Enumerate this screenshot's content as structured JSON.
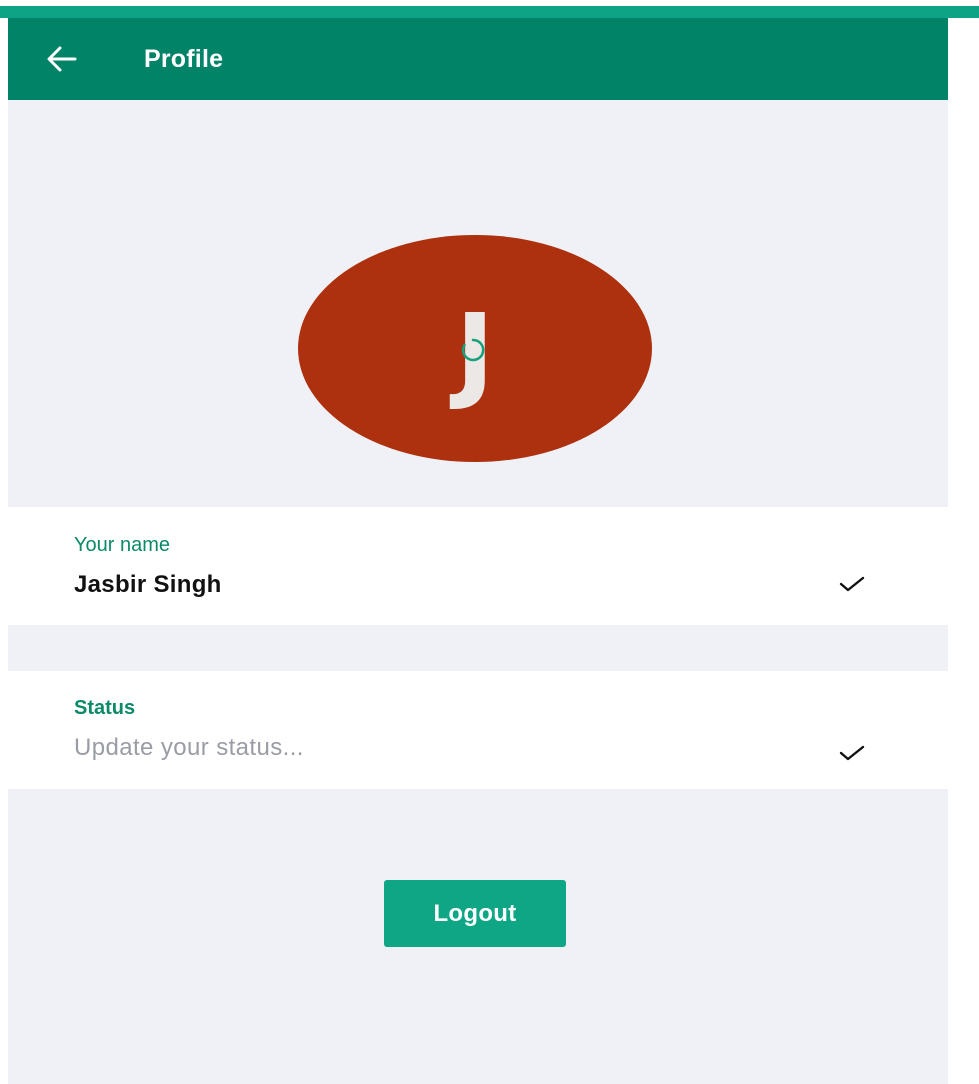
{
  "header": {
    "title": "Profile",
    "back_icon": "arrow-left-icon"
  },
  "avatar": {
    "initial": "J",
    "background_color": "#ad310e",
    "loading_icon": "spinner-icon"
  },
  "name_field": {
    "label": "Your name",
    "value": "Jasbir Singh",
    "confirm_icon": "check-icon"
  },
  "status_field": {
    "label": "Status",
    "value": "",
    "placeholder": "Update your status...",
    "confirm_icon": "check-icon"
  },
  "actions": {
    "logout_label": "Logout"
  },
  "colors": {
    "header": "#018368",
    "accent": "#0fa685",
    "label": "#0b8a68",
    "background": "#f0f1f6"
  }
}
